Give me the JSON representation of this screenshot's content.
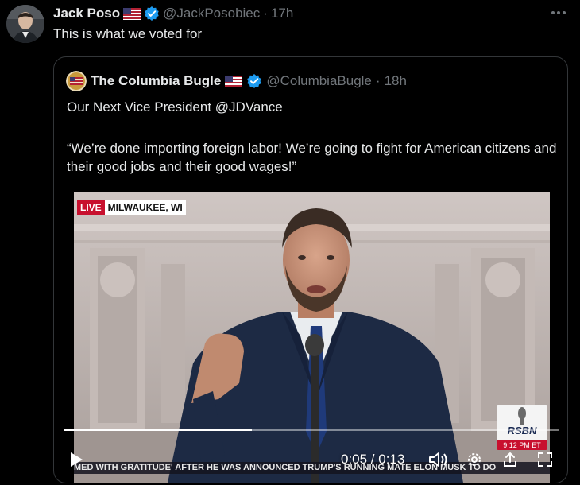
{
  "tweet": {
    "author_name": "Jack Poso",
    "author_handle": "@JackPosobiec",
    "separator": "·",
    "time": "17h",
    "text": "This is what we voted for"
  },
  "quote": {
    "author_name": "The Columbia Bugle",
    "author_handle": "@ColumbiaBugle",
    "separator": "·",
    "time": "18h",
    "line1": "Our Next Vice President @JDVance",
    "line2": "“We’re done importing foreign labor! We’re going to fight for American citizens and their good jobs and their good wages!”"
  },
  "video": {
    "live_label": "LIVE",
    "location": "MILWAUKEE, WI",
    "rsbn_logo": "RSBN",
    "rsbn_time": "9:12 PM ET",
    "ticker": "MED WITH GRATITUDE' AFTER HE WAS ANNOUNCED TRUMP'S RUNNING MATE    ELON MUSK TO DO",
    "time_display": "0:05 / 0:13",
    "progress": 0.38
  },
  "icons": {
    "more": "more-icon",
    "verified": "verified-badge-icon",
    "flag": "us-flag-icon",
    "play": "play-icon",
    "volume": "volume-icon",
    "settings": "settings-gear-icon",
    "fullscreen": "fullscreen-icon"
  },
  "colors": {
    "background": "#000000",
    "text": "#e7e9ea",
    "muted": "#71767b",
    "verified": "#1d9bf0",
    "border": "#333639",
    "live": "#c8102e"
  }
}
